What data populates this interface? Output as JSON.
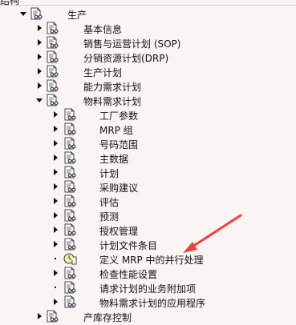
{
  "header": {
    "title": "结构"
  },
  "tree": [
    {
      "label": "生产",
      "level": 0,
      "state": "expanded",
      "icon": "doc-glasses-icon"
    },
    {
      "label": "基本信息",
      "level": 1,
      "state": "collapsed",
      "icon": "doc-glasses-icon"
    },
    {
      "label": "销售与运营计划 (SOP)",
      "level": 1,
      "state": "collapsed",
      "icon": "doc-glasses-icon"
    },
    {
      "label": "分销资源计划(DRP)",
      "level": 1,
      "state": "collapsed",
      "icon": "doc-glasses-icon"
    },
    {
      "label": "生产计划",
      "level": 1,
      "state": "collapsed",
      "icon": "doc-glasses-icon"
    },
    {
      "label": "能力需求计划",
      "level": 1,
      "state": "collapsed",
      "icon": "doc-glasses-icon"
    },
    {
      "label": "物料需求计划",
      "level": 1,
      "state": "expanded",
      "icon": "doc-glasses-icon"
    },
    {
      "label": "工厂参数",
      "level": 2,
      "state": "collapsed",
      "icon": "doc-glasses-icon"
    },
    {
      "label": "MRP 组",
      "level": 2,
      "state": "collapsed",
      "icon": "doc-glasses-icon"
    },
    {
      "label": "号码范围",
      "level": 2,
      "state": "collapsed",
      "icon": "doc-glasses-icon"
    },
    {
      "label": "主数据",
      "level": 2,
      "state": "collapsed",
      "icon": "doc-glasses-icon"
    },
    {
      "label": "计划",
      "level": 2,
      "state": "collapsed",
      "icon": "doc-glasses-icon"
    },
    {
      "label": "采购建议",
      "level": 2,
      "state": "collapsed",
      "icon": "doc-glasses-icon"
    },
    {
      "label": "评估",
      "level": 2,
      "state": "collapsed",
      "icon": "doc-glasses-icon"
    },
    {
      "label": "预测",
      "level": 2,
      "state": "collapsed",
      "icon": "doc-glasses-icon"
    },
    {
      "label": "授权管理",
      "level": 2,
      "state": "collapsed",
      "icon": "doc-glasses-icon"
    },
    {
      "label": "计划文件条目",
      "level": 2,
      "state": "collapsed",
      "icon": "doc-glasses-icon"
    },
    {
      "label": "定义 MRP 中的并行处理",
      "level": 2,
      "state": "leaf",
      "icon": "doc-clock-icon"
    },
    {
      "label": "检查性能设置",
      "level": 2,
      "state": "collapsed",
      "icon": "doc-glasses-icon"
    },
    {
      "label": "请求计划的业务附加项",
      "level": 2,
      "state": "leaf",
      "icon": "doc-glasses-icon"
    },
    {
      "label": "物料需求计划的应用程序",
      "level": 2,
      "state": "collapsed",
      "icon": "doc-glasses-icon"
    },
    {
      "label": "产库存控制",
      "level": 1,
      "state": "collapsed",
      "icon": "doc-glasses-icon"
    }
  ],
  "annotation": {
    "color": "#e8463c",
    "icon": "red-arrow-icon"
  }
}
